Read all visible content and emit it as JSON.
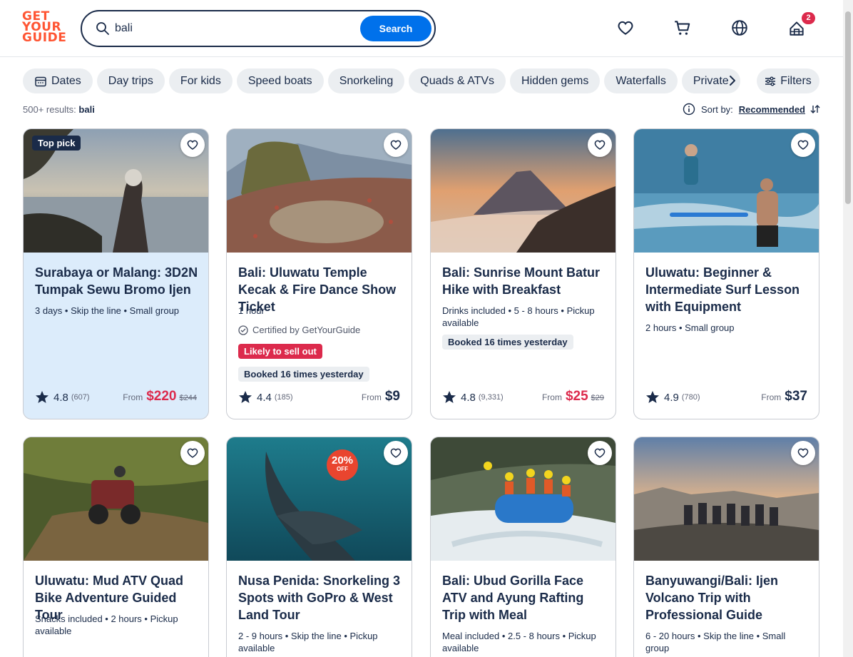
{
  "header": {
    "logo_lines": [
      "GET",
      "YOUR",
      "GUIDE"
    ],
    "search_value": "bali",
    "search_button": "Search",
    "cart_badge": "2"
  },
  "chips": [
    "Dates",
    "Day trips",
    "For kids",
    "Speed boats",
    "Snorkeling",
    "Quads & ATVs",
    "Hidden gems",
    "Waterfalls",
    "Private"
  ],
  "filters_label": "Filters",
  "results": {
    "count": "500+ results:",
    "query": "bali"
  },
  "sort": {
    "label": "Sort by:",
    "value": "Recommended"
  },
  "cards": [
    {
      "title": "Surabaya or Malang: 3D2N Tumpak Sewu Bromo Ijen",
      "meta": "3 days • Skip the line • Small group",
      "badge": "Top pick",
      "rating": "4.8",
      "reviews": "(607)",
      "from": "From",
      "price": "$220",
      "old_price": "$244"
    },
    {
      "title": "Bali: Uluwatu Temple Kecak & Fire Dance Show Ticket",
      "meta": "1 hour",
      "certified": "Certified by GetYourGuide",
      "pill_red": "Likely to sell out",
      "pill_gray": "Booked 16 times yesterday",
      "rating": "4.4",
      "reviews": "(185)",
      "from": "From",
      "price": "$9"
    },
    {
      "title": "Bali: Sunrise Mount Batur Hike with Breakfast",
      "meta": "Drinks included • 5 - 8 hours • Pickup available",
      "pill_gray": "Booked 16 times yesterday",
      "rating": "4.8",
      "reviews": "(9,331)",
      "from": "From",
      "price": "$25",
      "old_price": "$29"
    },
    {
      "title": "Uluwatu: Beginner & Intermediate Surf Lesson with Equipment",
      "meta": "2 hours • Small group",
      "rating": "4.9",
      "reviews": "(780)",
      "from": "From",
      "price": "$37"
    },
    {
      "title": "Uluwatu: Mud ATV Quad Bike Adventure Guided Tour",
      "meta": "Snacks included • 2 hours • Pickup available"
    },
    {
      "title": "Nusa Penida: Snorkeling 3 Spots with GoPro & West Land Tour",
      "meta": "2 - 9 hours • Skip the line • Pickup available",
      "discount": "20%",
      "discount_sub": "OFF"
    },
    {
      "title": "Bali: Ubud Gorilla Face ATV and Ayung Rafting Trip with Meal",
      "meta": "Meal included • 2.5 - 8 hours • Pickup available"
    },
    {
      "title": "Banyuwangi/Bali: Ijen Volcano Trip with Professional Guide",
      "meta": "6 - 20 hours • Skip the line • Small group"
    }
  ]
}
